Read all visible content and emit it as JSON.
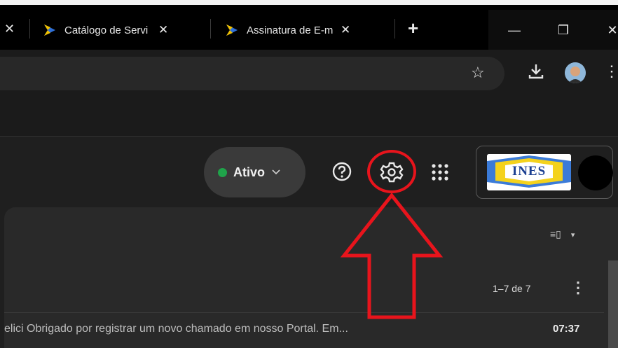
{
  "browser": {
    "tabs": [
      {
        "label": "Catálogo de Servi",
        "close": "✕"
      },
      {
        "label": "Assinatura de E-m",
        "close": "✕"
      }
    ],
    "partial_tab_close": "✕",
    "new_tab": "+",
    "window": {
      "minimize": "—",
      "restore": "❐",
      "close": "✕"
    },
    "toolbar": {
      "bookmark_icon": "star-icon",
      "download_icon": "download-icon",
      "menu": "⋮",
      "star": "☆"
    }
  },
  "gmail": {
    "status": {
      "label": "Ativo",
      "chevron": "⌄",
      "color": "#1fa34a"
    },
    "account_logo_text": "INES",
    "list": {
      "pager": "1–7 de 7",
      "more": "⋮",
      "density_icon": "≡▯",
      "density_caret": "▾",
      "rows": [
        {
          "snippet": "elici Obrigado por registrar um novo chamado em nosso Portal. Em...",
          "time": "07:37"
        }
      ]
    }
  },
  "annotation": {
    "color": "#e8141c",
    "target": "settings-gear"
  }
}
